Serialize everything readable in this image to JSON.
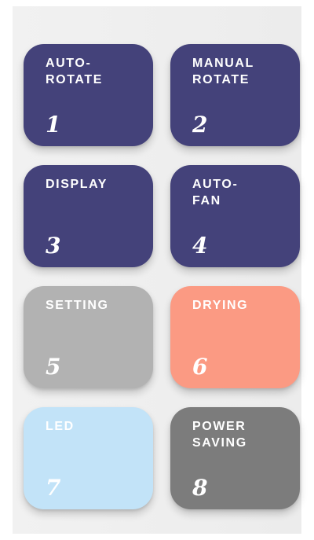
{
  "buttons": [
    {
      "label": "AUTO-\nROTATE",
      "number": "1",
      "bg": "#44427a",
      "fg": "#ffffff"
    },
    {
      "label": "MANUAL\nROTATE",
      "number": "2",
      "bg": "#44427a",
      "fg": "#ffffff"
    },
    {
      "label": "DISPLAY",
      "number": "3",
      "bg": "#44427a",
      "fg": "#ffffff"
    },
    {
      "label": "AUTO-\nFAN",
      "number": "4",
      "bg": "#44427a",
      "fg": "#ffffff"
    },
    {
      "label": "SETTING",
      "number": "5",
      "bg": "#b2b2b2",
      "fg": "#ffffff"
    },
    {
      "label": "DRYING",
      "number": "6",
      "bg": "#fb9a83",
      "fg": "#ffffff"
    },
    {
      "label": "LED",
      "number": "7",
      "bg": "#c2e3f8",
      "fg": "#ffffff"
    },
    {
      "label": "POWER\nSAVING",
      "number": "8",
      "bg": "#7c7c7c",
      "fg": "#ffffff"
    }
  ]
}
